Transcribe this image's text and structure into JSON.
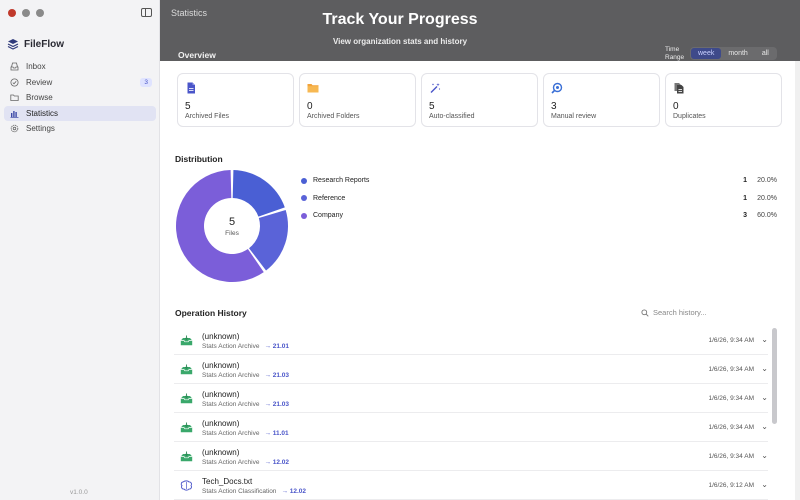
{
  "app": {
    "name": "FileFlow",
    "version": "v1.0.0"
  },
  "sidebar": {
    "items": [
      {
        "label": "Inbox",
        "icon": "inbox-icon"
      },
      {
        "label": "Review",
        "icon": "check-circle-icon",
        "badge": "3"
      },
      {
        "label": "Browse",
        "icon": "folder-icon"
      },
      {
        "label": "Statistics",
        "icon": "bar-chart-icon",
        "active": true
      },
      {
        "label": "Settings",
        "icon": "gear-icon"
      }
    ]
  },
  "header": {
    "breadcrumb": "Statistics",
    "title": "Track Your Progress",
    "subtitle": "View organization stats and history",
    "overview_title": "Overview",
    "range_label": "Time Range",
    "range_options": [
      "week",
      "month",
      "all"
    ],
    "range_selected": "week"
  },
  "stats": [
    {
      "value": "5",
      "label": "Archived Files",
      "icon": "file-icon",
      "color": "#4a55c9"
    },
    {
      "value": "0",
      "label": "Archived Folders",
      "icon": "folder-icon",
      "color": "#f2a33a"
    },
    {
      "value": "5",
      "label": "Auto-classified",
      "icon": "magic-wand-icon",
      "color": "#4a55c9"
    },
    {
      "value": "3",
      "label": "Manual review",
      "icon": "eye-search-icon",
      "color": "#3a6fd6"
    },
    {
      "value": "0",
      "label": "Duplicates",
      "icon": "duplicate-icon",
      "color": "#555555"
    }
  ],
  "distribution": {
    "title": "Distribution",
    "center_value": "5",
    "center_label": "Files",
    "items": [
      {
        "label": "Research Reports",
        "count": "1",
        "percent": "20.0%",
        "value": 1,
        "color": "#4a5fd4"
      },
      {
        "label": "Reference",
        "count": "1",
        "percent": "20.0%",
        "value": 1,
        "color": "#5a63d8"
      },
      {
        "label": "Company",
        "count": "3",
        "percent": "60.0%",
        "value": 3,
        "color": "#7b5ed9"
      }
    ]
  },
  "history": {
    "title": "Operation History",
    "search_placeholder": "Search history...",
    "rows": [
      {
        "name": "(unknown)",
        "action": "Stats Action Archive",
        "dest": "→ 21.01",
        "time": "1/6/26, 9:34 AM",
        "icon": "archive-tray-icon"
      },
      {
        "name": "(unknown)",
        "action": "Stats Action Archive",
        "dest": "→ 21.03",
        "time": "1/6/26, 9:34 AM",
        "icon": "archive-tray-icon"
      },
      {
        "name": "(unknown)",
        "action": "Stats Action Archive",
        "dest": "→ 21.03",
        "time": "1/6/26, 9:34 AM",
        "icon": "archive-tray-icon"
      },
      {
        "name": "(unknown)",
        "action": "Stats Action Archive",
        "dest": "→ 11.01",
        "time": "1/6/26, 9:34 AM",
        "icon": "archive-tray-icon"
      },
      {
        "name": "(unknown)",
        "action": "Stats Action Archive",
        "dest": "→ 12.02",
        "time": "1/6/26, 9:34 AM",
        "icon": "archive-tray-icon"
      },
      {
        "name": "Tech_Docs.txt",
        "action": "Stats Action Classification",
        "dest": "→ 12.02",
        "time": "1/6/26, 9:12 AM",
        "icon": "brain-icon"
      }
    ]
  }
}
